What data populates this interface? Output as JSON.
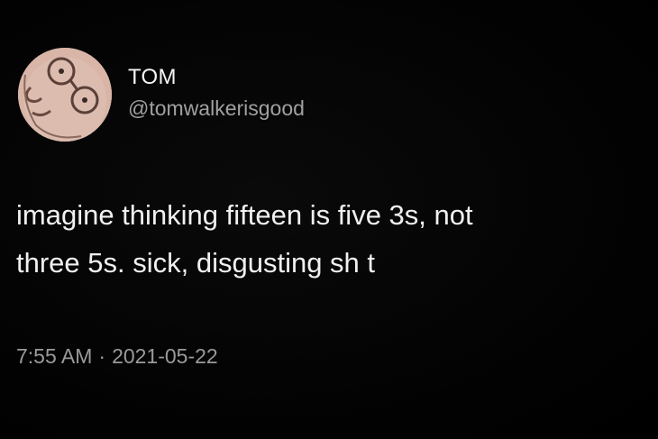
{
  "tweet": {
    "author": {
      "display_name": "TOM",
      "handle": "@tomwalkerisgood",
      "avatar_icon": "cartoon-face-with-glasses"
    },
    "text_lines": [
      "imagine thinking fifteen is five 3s, not",
      "three 5s. sick, disgusting sh t"
    ],
    "time": "7:55 AM",
    "separator": "·",
    "date": "2021-05-22"
  },
  "colors": {
    "background": "#000000",
    "primary_text": "#f0f0f0",
    "secondary_text": "#9a9a9a",
    "avatar_bg": "#d9b8a8"
  }
}
